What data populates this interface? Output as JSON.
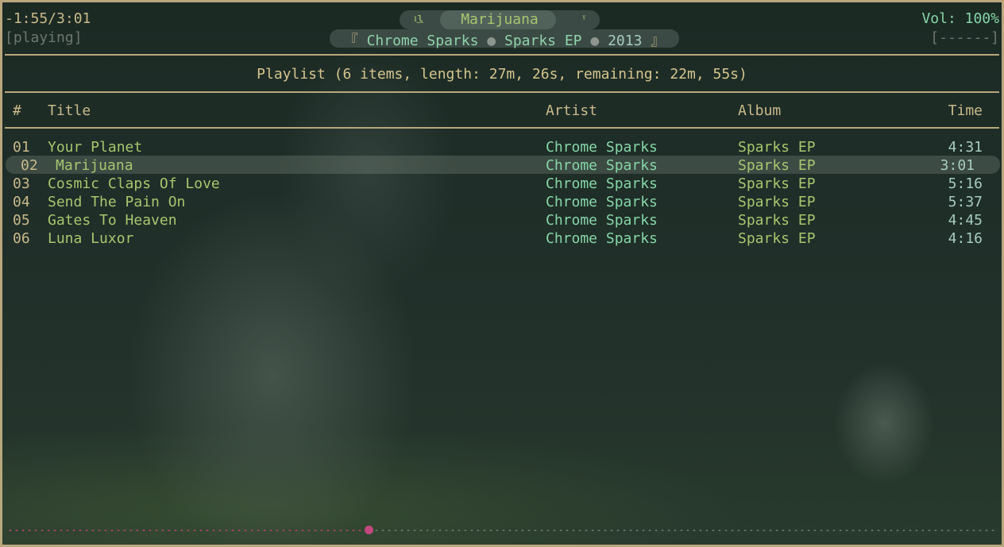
{
  "status": {
    "time": "-1:55/3:01",
    "state": "[playing]",
    "volume": "Vol: 100%",
    "volume_bar": "[------]"
  },
  "now_playing": {
    "title": "Marijuana",
    "artist": "Chrome Sparks",
    "album": "Sparks EP",
    "year": "2013",
    "open_bracket": "『",
    "close_bracket": "』",
    "separator": "●",
    "left_icon": "grass-icon",
    "right_icon": "sprout-icon"
  },
  "playlist": {
    "header": "Playlist (6 items, length: 27m, 26s, remaining: 22m, 55s)",
    "columns": {
      "number": "#",
      "title": "Title",
      "artist": "Artist",
      "album": "Album",
      "time": "Time"
    },
    "rows": [
      {
        "num": "01",
        "title": "Your Planet",
        "artist": "Chrome Sparks",
        "album": "Sparks EP",
        "time": "4:31"
      },
      {
        "num": "02",
        "title": "Marijuana",
        "artist": "Chrome Sparks",
        "album": "Sparks EP",
        "time": "3:01"
      },
      {
        "num": "03",
        "title": "Cosmic Claps Of Love",
        "artist": "Chrome Sparks",
        "album": "Sparks EP",
        "time": "5:16"
      },
      {
        "num": "04",
        "title": "Send The Pain On",
        "artist": "Chrome Sparks",
        "album": "Sparks EP",
        "time": "5:37"
      },
      {
        "num": "05",
        "title": "Gates To Heaven",
        "artist": "Chrome Sparks",
        "album": "Sparks EP",
        "time": "4:45"
      },
      {
        "num": "06",
        "title": "Luna Luxor",
        "artist": "Chrome Sparks",
        "album": "Sparks EP",
        "time": "4:16"
      }
    ],
    "selected_index": 1
  },
  "progress": {
    "fraction": 0.365
  },
  "colors": {
    "border": "#b9a77d",
    "title_green": "#a7c66f",
    "artist_green": "#86d6a8",
    "seek_played": "#b0436e",
    "seek_knob": "#c2487d"
  }
}
